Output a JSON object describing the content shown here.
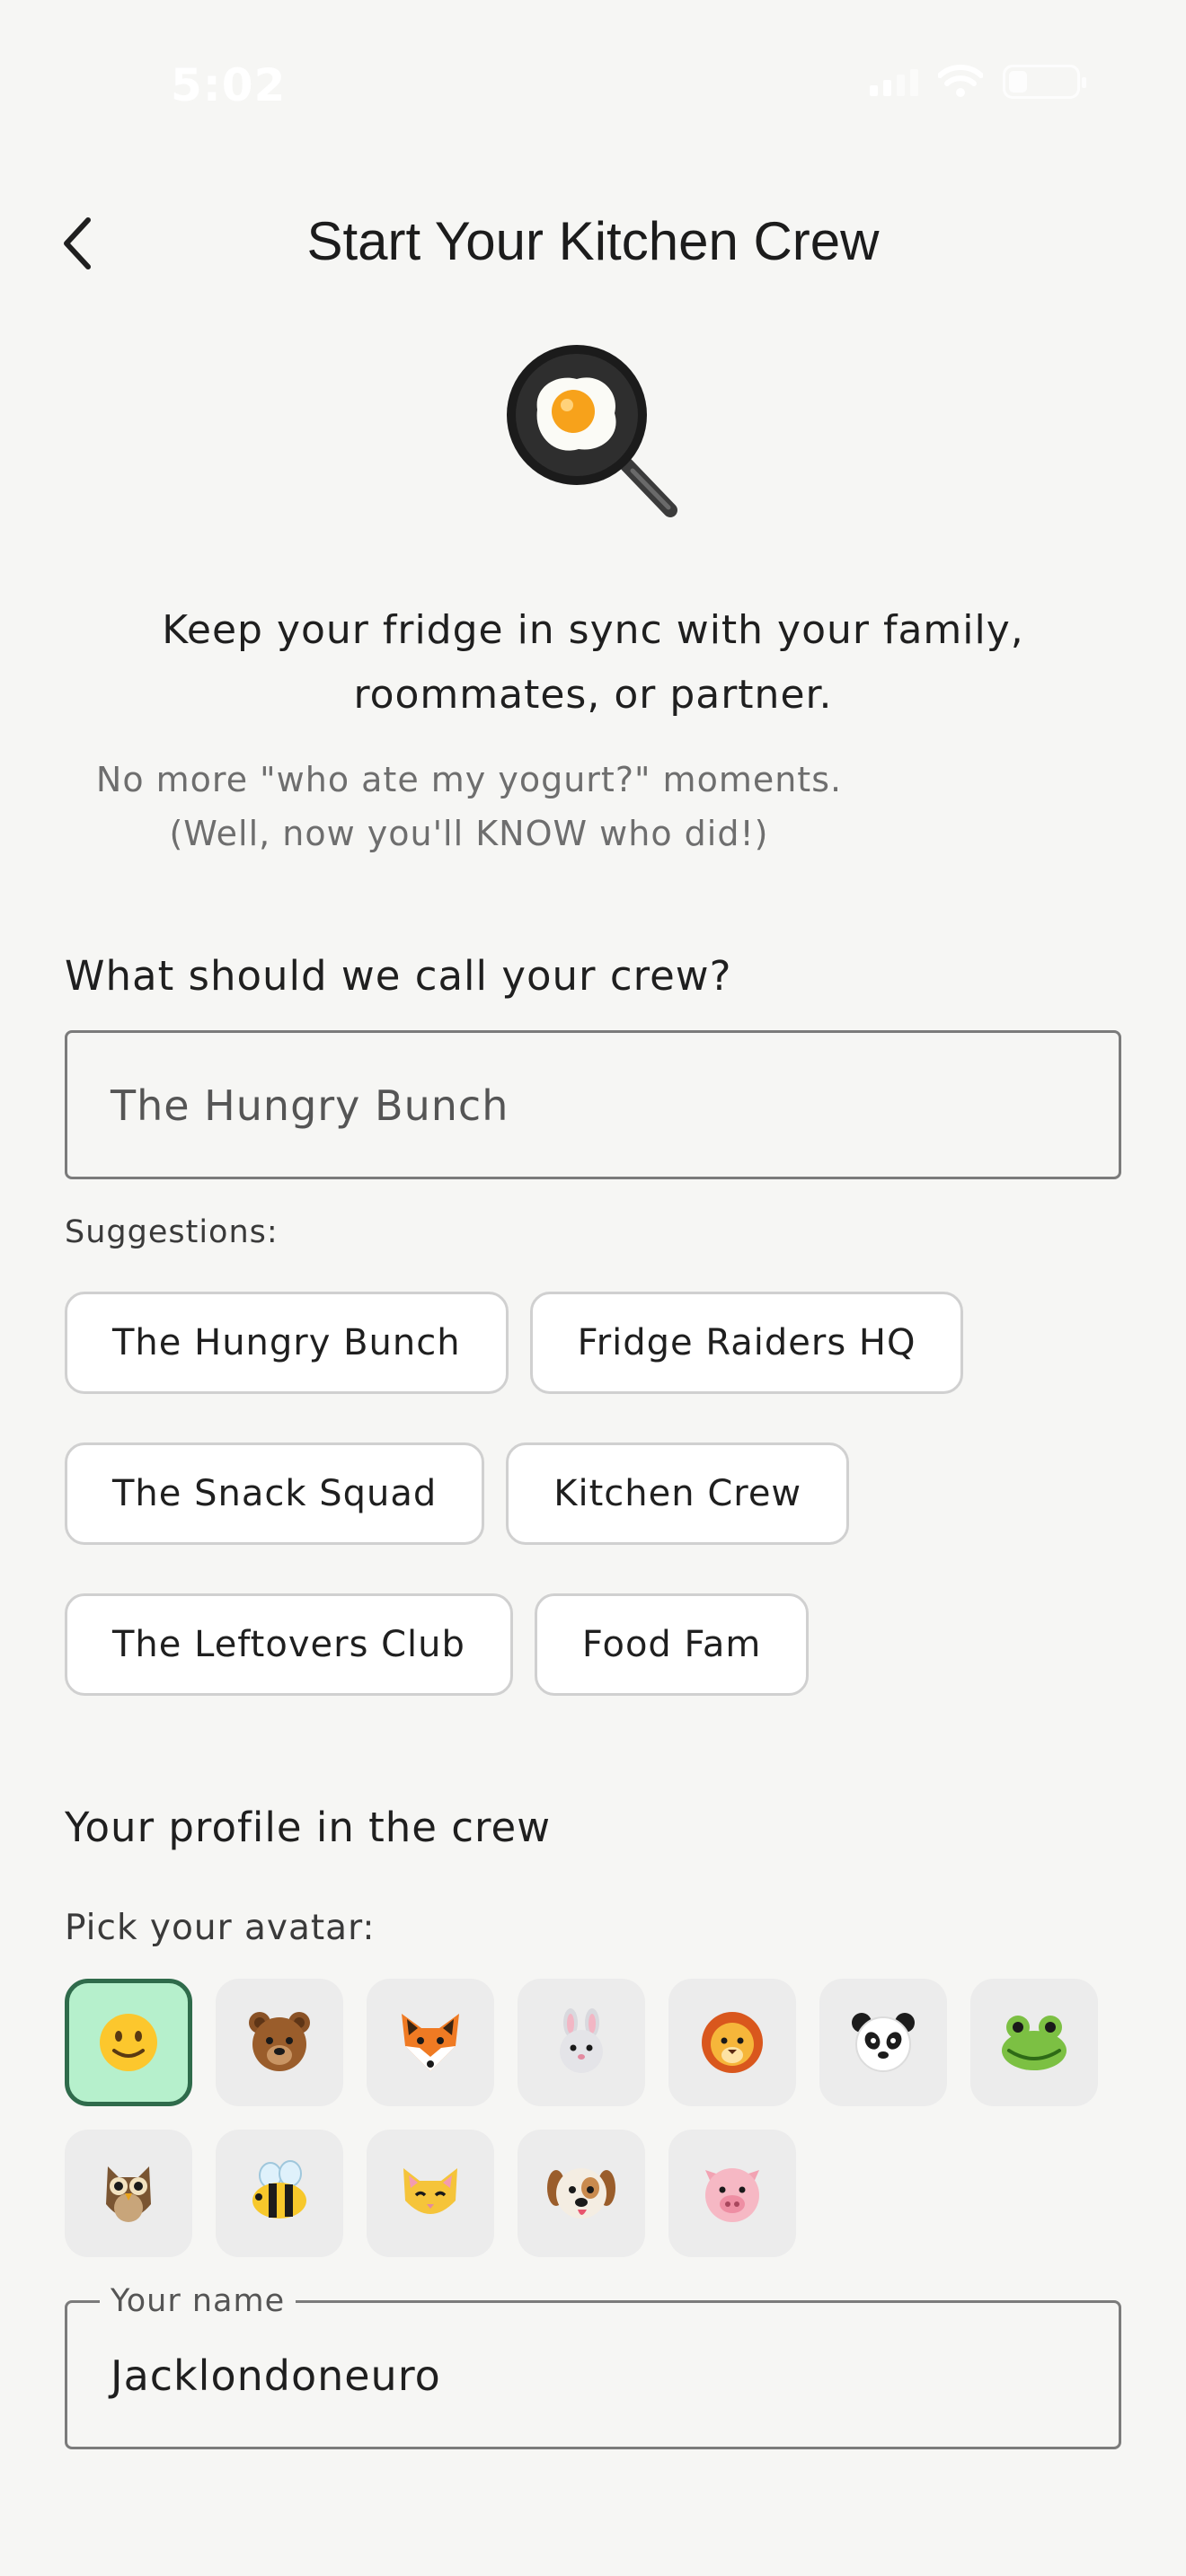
{
  "status_bar": {
    "time": "5:02"
  },
  "header": {
    "title": "Start Your Kitchen Crew"
  },
  "intro": {
    "tagline_line1": "Keep your fridge in sync with your family,",
    "tagline_line2": "roommates, or partner.",
    "note_line1": "No more \"who ate my yogurt?\" moments.",
    "note_line2": "(Well, now you'll KNOW who did!)"
  },
  "crew": {
    "heading": "What should we call your crew?",
    "name_value": "The Hungry Bunch",
    "suggestions_label": "Suggestions:",
    "suggestions": [
      "The Hungry Bunch",
      "Fridge Raiders HQ",
      "The Snack Squad",
      "Kitchen Crew",
      "The Leftovers Club",
      "Food Fam"
    ]
  },
  "profile": {
    "heading": "Your profile in the crew",
    "avatar_label": "Pick your avatar:",
    "avatars": [
      "smiley-face",
      "bear",
      "fox",
      "rabbit",
      "lion",
      "panda",
      "frog",
      "owl",
      "bee",
      "cat",
      "dog",
      "pig"
    ],
    "selected_avatar": "smiley-face",
    "name_label": "Your name",
    "name_value": "Jacklondoneuro"
  },
  "colors": {
    "background": "#f6f6f4",
    "selected_avatar_fill": "#b6f0cc",
    "selected_avatar_border": "#2f6b4b"
  }
}
